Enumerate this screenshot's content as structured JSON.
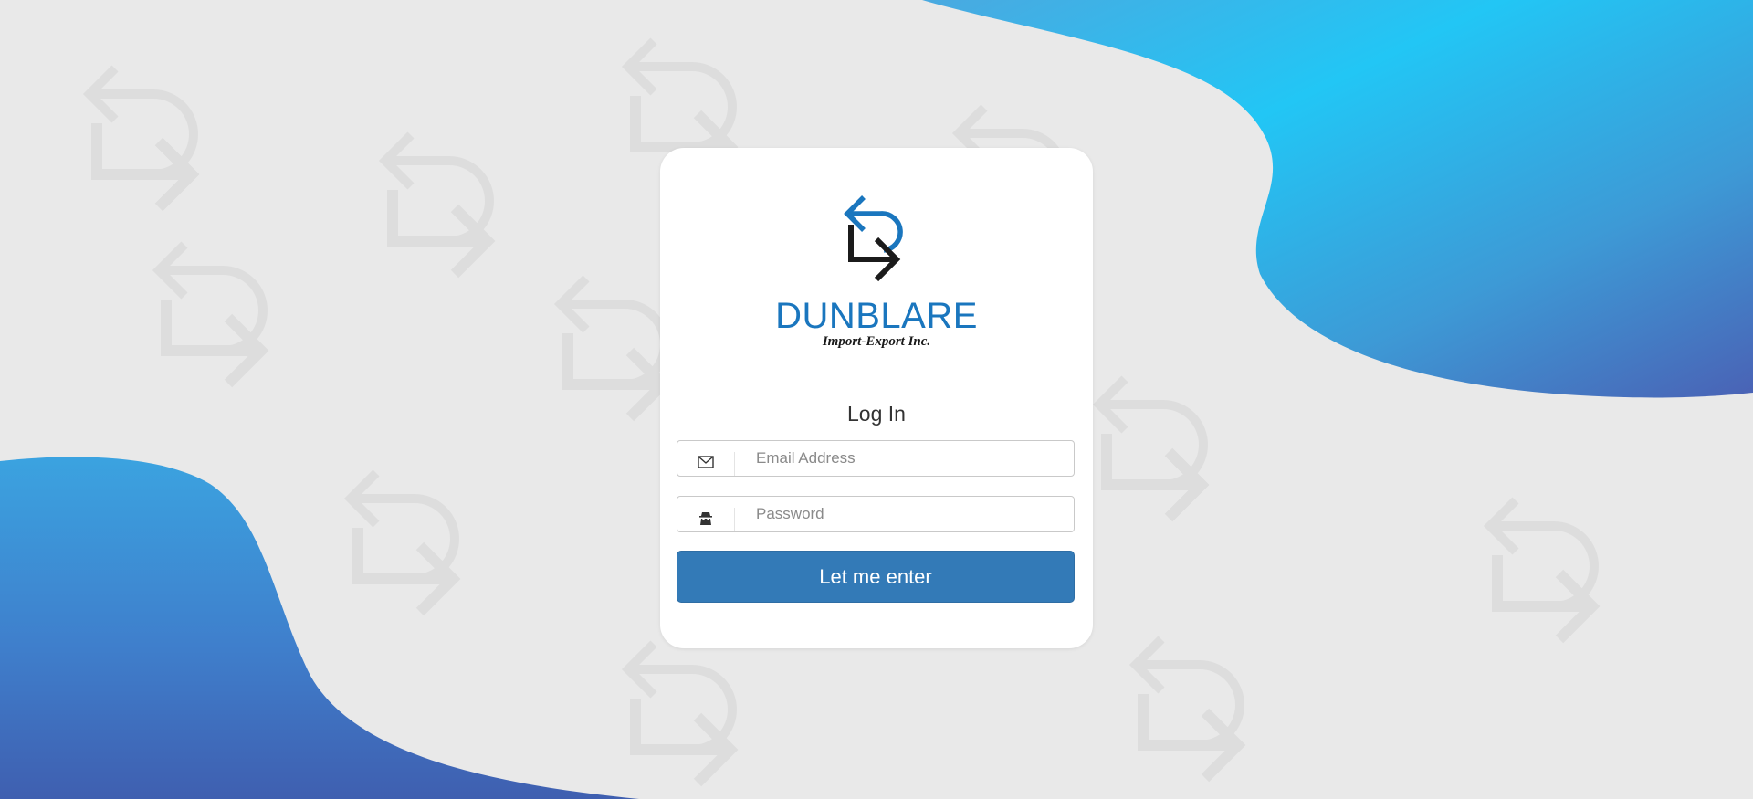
{
  "brand": {
    "name": "DUNBLARE",
    "subtitle": "Import-Export Inc."
  },
  "login": {
    "title": "Log In",
    "email_placeholder": "Email Address",
    "password_placeholder": "Password",
    "submit_label": "Let me enter"
  },
  "icons": {
    "email": "envelope-icon",
    "password": "incognito-icon",
    "logo": "dunblare-arrows-logo"
  },
  "colors": {
    "background": "#e9e9e9",
    "brand_blue": "#1a76be",
    "button_blue": "#337ab7",
    "wave_cyan": "#22c6f5",
    "wave_indigo": "#4a62b5"
  }
}
